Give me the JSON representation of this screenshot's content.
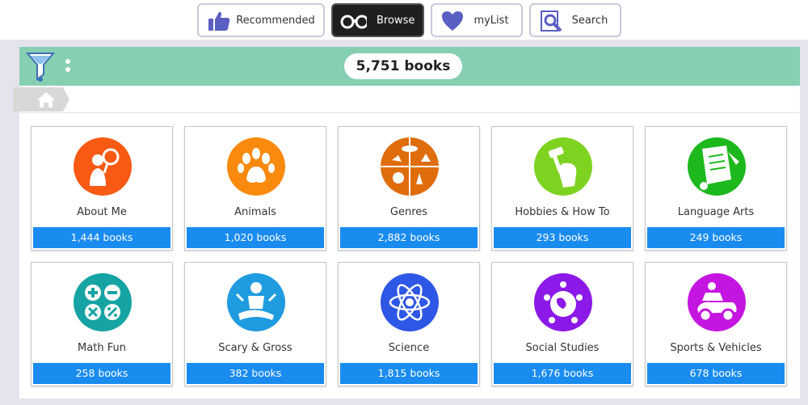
{
  "nav": [
    {
      "id": "recommended",
      "label": "Recommended",
      "icon": "thumbs-up-icon",
      "active": false
    },
    {
      "id": "browse",
      "label": "Browse",
      "icon": "binoculars-icon",
      "active": true
    },
    {
      "id": "mylist",
      "label": "myList",
      "icon": "heart-icon",
      "active": false
    },
    {
      "id": "search",
      "label": "Search",
      "icon": "magnifier-book-icon",
      "active": false
    }
  ],
  "filterbar": {
    "count": "5,751 books"
  },
  "breadcrumb": {
    "home_icon": "home-icon"
  },
  "categories": [
    {
      "name": "About Me",
      "count": "1,444 books",
      "color": "#f85a14",
      "icon": "person-magnifier-icon"
    },
    {
      "name": "Animals",
      "count": "1,020 books",
      "color": "#f98a0e",
      "icon": "paw-icon"
    },
    {
      "name": "Genres",
      "count": "2,882 books",
      "color": "#df6d0c",
      "icon": "genres-collage-icon"
    },
    {
      "name": "Hobbies & How To",
      "count": "293 books",
      "color": "#7ed321",
      "icon": "hammer-fist-icon"
    },
    {
      "name": "Language Arts",
      "count": "249 books",
      "color": "#1cb81c",
      "icon": "scroll-icon"
    },
    {
      "name": "Math Fun",
      "count": "258 books",
      "color": "#16a3a3",
      "icon": "math-operators-icon"
    },
    {
      "name": "Scary & Gross",
      "count": "382 books",
      "color": "#1f9be0",
      "icon": "zombie-icon"
    },
    {
      "name": "Science",
      "count": "1,815 books",
      "color": "#2f57e6",
      "icon": "atom-icon"
    },
    {
      "name": "Social Studies",
      "count": "1,676 books",
      "color": "#8c19e8",
      "icon": "globe-people-icon"
    },
    {
      "name": "Sports & Vehicles",
      "count": "678 books",
      "color": "#c416e0",
      "icon": "vehicle-icon"
    }
  ]
}
